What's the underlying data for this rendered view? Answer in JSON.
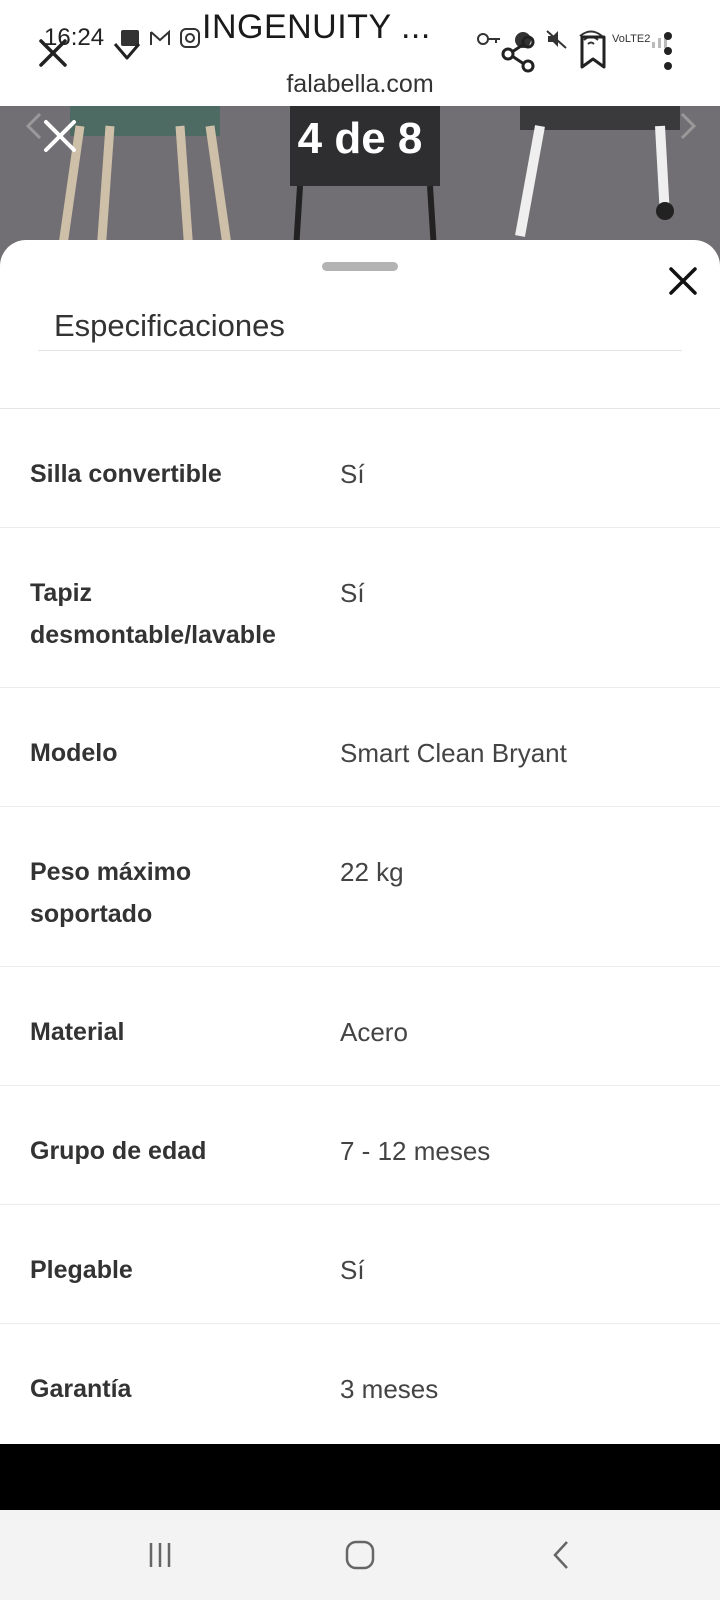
{
  "status_bar": {
    "time": "16:24",
    "network_label": "VoLTE2"
  },
  "browser": {
    "page_title": "INGENUITY ...",
    "domain": "falabella.com"
  },
  "gallery": {
    "counter": "4 de 8"
  },
  "specs": {
    "title": "Especificaciones",
    "rows": [
      {
        "label": "Silla convertible",
        "value": "Sí"
      },
      {
        "label": "Tapiz desmontable/lavable",
        "value": "Sí"
      },
      {
        "label": "Modelo",
        "value": "Smart Clean Bryant"
      },
      {
        "label": "Peso máximo soportado",
        "value": "22 kg"
      },
      {
        "label": "Material",
        "value": "Acero"
      },
      {
        "label": "Grupo de edad",
        "value": "7 - 12 meses"
      },
      {
        "label": "Plegable",
        "value": "Sí"
      },
      {
        "label": "Garantía",
        "value": "3 meses"
      }
    ]
  },
  "colors": {
    "sheet_bg": "#ffffff",
    "gallery_bg": "#6f6d71",
    "text_primary": "#333333",
    "divider": "#ececec"
  },
  "icons": {
    "browser_close": "close-icon",
    "download": "download-icon",
    "share": "share-icon",
    "bookmark": "bookmark-icon",
    "more": "more-vertical-icon",
    "gallery_close": "close-icon",
    "sheet_close": "close-icon",
    "nav_recents": "recents-icon",
    "nav_home": "home-icon",
    "nav_back": "back-icon"
  }
}
